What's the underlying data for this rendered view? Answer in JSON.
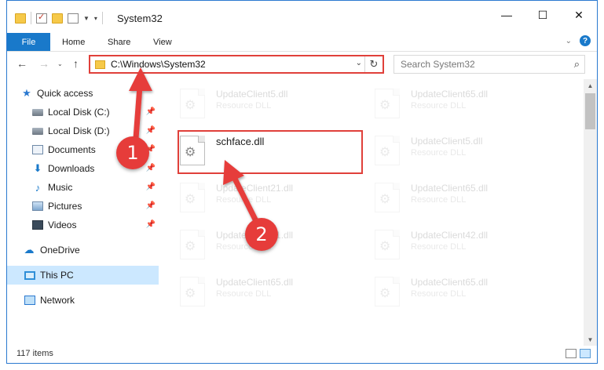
{
  "window": {
    "title": "System32"
  },
  "window_controls": {
    "minimize": "—",
    "maximize": "☐",
    "close": "✕"
  },
  "ribbon": {
    "tabs": [
      "File",
      "Home",
      "Share",
      "View"
    ],
    "help": "?"
  },
  "address": {
    "path": "C:\\Windows\\System32",
    "search_placeholder": "Search System32"
  },
  "nav": {
    "items": [
      {
        "label": "Quick access",
        "icon": "star-icon"
      },
      {
        "label": "Local Disk (C:)",
        "icon": "disk-icon",
        "pinned": true
      },
      {
        "label": "Local Disk (D:)",
        "icon": "disk-icon",
        "pinned": true
      },
      {
        "label": "Documents",
        "icon": "documents-icon",
        "pinned": true
      },
      {
        "label": "Downloads",
        "icon": "downloads-icon",
        "pinned": true
      },
      {
        "label": "Music",
        "icon": "music-icon",
        "pinned": true
      },
      {
        "label": "Pictures",
        "icon": "pictures-icon",
        "pinned": true
      },
      {
        "label": "Videos",
        "icon": "videos-icon",
        "pinned": true
      },
      {
        "label": "OneDrive",
        "icon": "cloud-icon"
      },
      {
        "label": "This PC",
        "icon": "pc-icon",
        "selected": true
      },
      {
        "label": "Network",
        "icon": "network-icon"
      }
    ]
  },
  "files": [
    {
      "name": "UpdateClient5.dll",
      "type": "Resource DLL"
    },
    {
      "name": "UpdateClient65.dll",
      "type": "Resource DLL"
    },
    {
      "name": "schface.dll",
      "type": ""
    },
    {
      "name": "UpdateClient5.dll",
      "type": "Resource DLL"
    },
    {
      "name": "UpdateClient21.dll",
      "type": "Resource DLL"
    },
    {
      "name": "UpdateClient65.dll",
      "type": "Resource DLL"
    },
    {
      "name": "UpdateClient21.dll",
      "type": "Resource DLL"
    },
    {
      "name": "UpdateClient42.dll",
      "type": "Resource DLL"
    },
    {
      "name": "UpdateClient65.dll",
      "type": "Resource DLL"
    },
    {
      "name": "UpdateClient65.dll",
      "type": "Resource DLL"
    }
  ],
  "status": {
    "item_count": "117 items"
  },
  "annotations": {
    "step1": "1",
    "step2": "2"
  },
  "colors": {
    "accent": "#1979ca",
    "annotation": "#e63c3a",
    "selection": "#cce8ff"
  }
}
